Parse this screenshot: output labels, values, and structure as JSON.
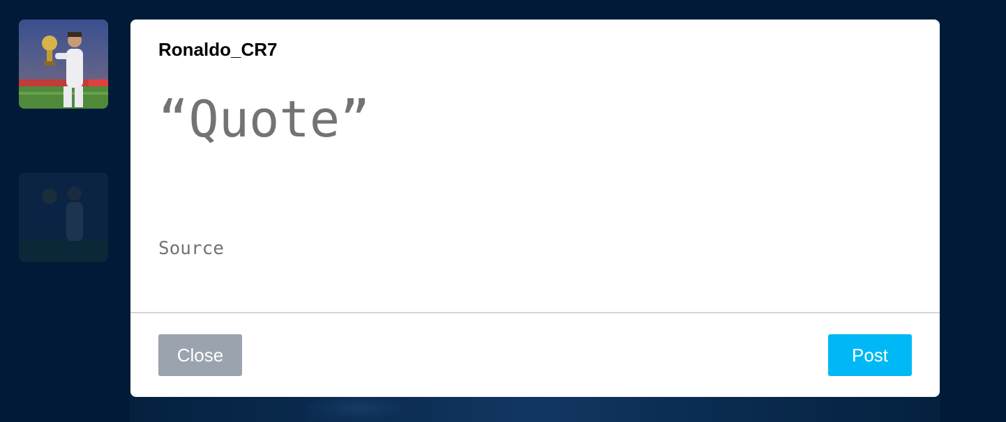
{
  "modal": {
    "username": "Ronaldo_CR7",
    "quote_placeholder": "“Quote”",
    "quote_value": "",
    "source_placeholder": "Source",
    "source_value": "",
    "close_label": "Close",
    "post_label": "Post"
  },
  "colors": {
    "page_background": "#011a37",
    "modal_background": "#ffffff",
    "close_button": "#9aa3ae",
    "post_button": "#00b8f6",
    "placeholder_text": "#737373"
  },
  "icons": {
    "avatar": "user-avatar-photo"
  }
}
